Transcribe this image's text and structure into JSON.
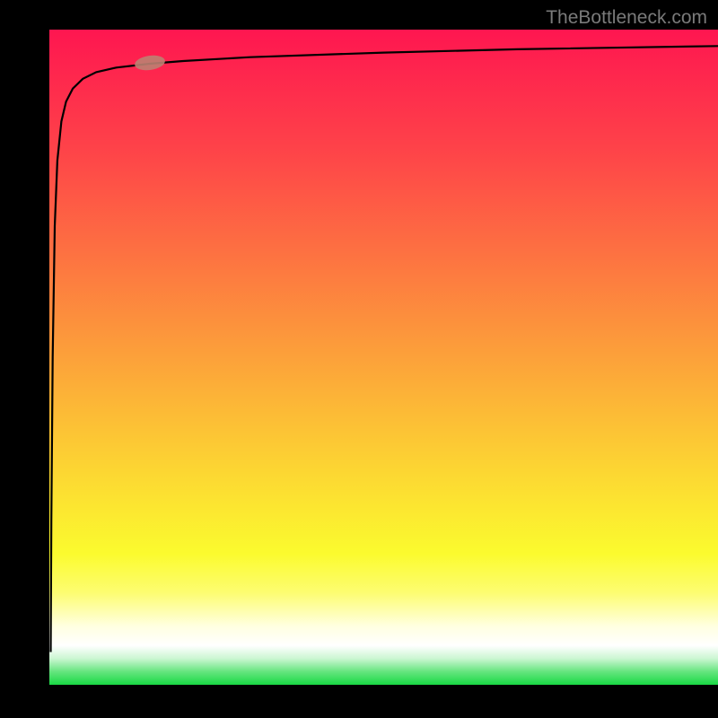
{
  "watermark": "TheBottleneck.com",
  "colors": {
    "bg": "#000000",
    "watermark": "#7a7a7a",
    "curve": "#000000",
    "marker": "#bd8172",
    "gradient_stops": [
      {
        "offset": 0,
        "color": "#fe1650"
      },
      {
        "offset": 0.18,
        "color": "#fe4249"
      },
      {
        "offset": 0.35,
        "color": "#fd7441"
      },
      {
        "offset": 0.52,
        "color": "#fca739"
      },
      {
        "offset": 0.68,
        "color": "#fcd832"
      },
      {
        "offset": 0.8,
        "color": "#fbfb2e"
      },
      {
        "offset": 0.86,
        "color": "#fdfd72"
      },
      {
        "offset": 0.91,
        "color": "#ffffe0"
      },
      {
        "offset": 0.94,
        "color": "#ffffff"
      },
      {
        "offset": 0.96,
        "color": "#cbf6d2"
      },
      {
        "offset": 0.98,
        "color": "#65e57e"
      },
      {
        "offset": 1.0,
        "color": "#19d944"
      }
    ]
  },
  "chart_data": {
    "type": "line",
    "title": "",
    "xlabel": "",
    "ylabel": "",
    "xlim": [
      0,
      100
    ],
    "ylim": [
      0,
      100
    ],
    "series": [
      {
        "name": "curve",
        "x": [
          0.2,
          0.3,
          0.5,
          0.8,
          1.2,
          1.8,
          2.5,
          3.5,
          5,
          7,
          10,
          15,
          20,
          30,
          50,
          70,
          100
        ],
        "values": [
          5,
          25,
          50,
          70,
          80,
          86,
          89,
          91,
          92.5,
          93.5,
          94.2,
          94.8,
          95.2,
          95.8,
          96.5,
          97,
          97.5
        ]
      }
    ],
    "annotations": [
      {
        "type": "marker",
        "x": 15,
        "y": 94.8
      }
    ]
  }
}
